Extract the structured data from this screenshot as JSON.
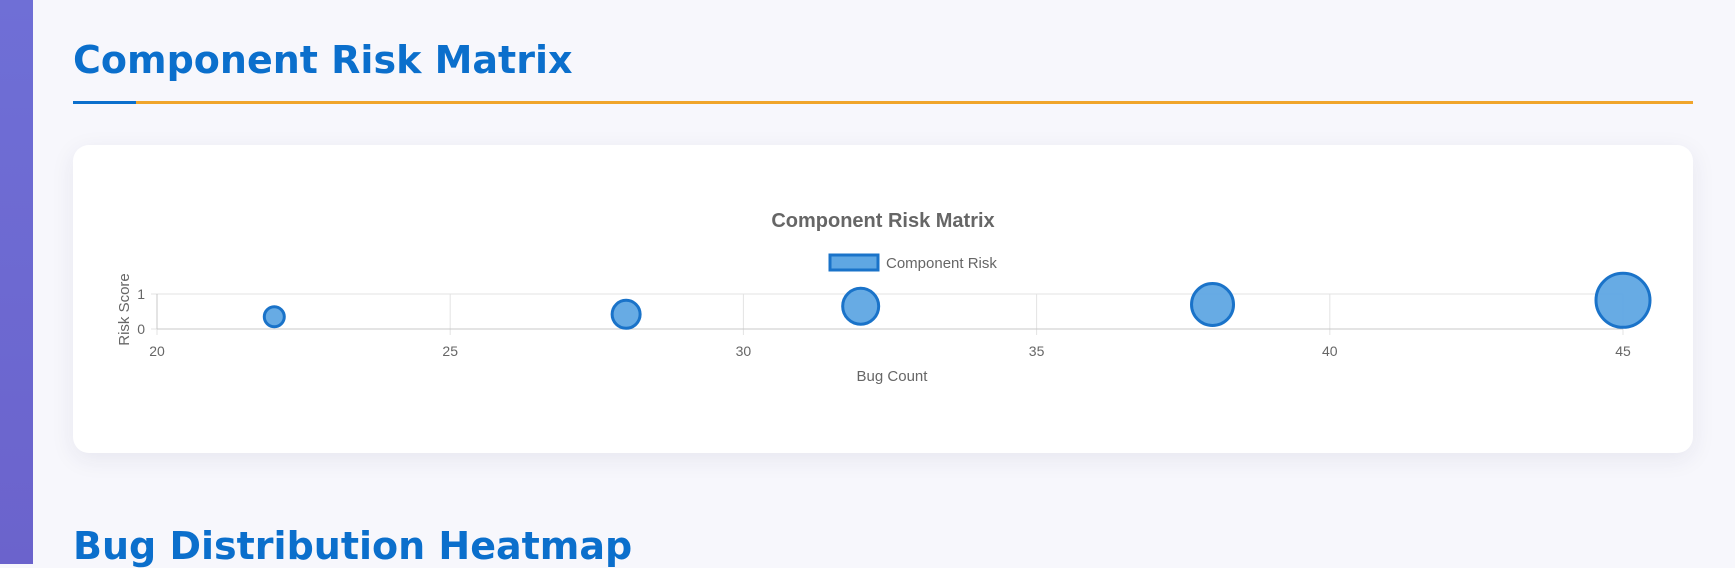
{
  "sections": {
    "risk_title": "Component Risk Matrix",
    "heatmap_title": "Bug Distribution Heatmap"
  },
  "colors": {
    "accent_blue": "#0b6fcc",
    "accent_orange": "#f0a52b",
    "point_fill": "#5fa7e3",
    "point_stroke": "#1a73c9"
  },
  "chart_data": {
    "type": "scatter",
    "title": "Component Risk Matrix",
    "xlabel": "Bug Count",
    "ylabel": "Risk Score",
    "xlim": [
      20,
      45
    ],
    "ylim": [
      0,
      1
    ],
    "xticks": [
      20,
      25,
      30,
      35,
      40,
      45
    ],
    "yticks": [
      0,
      1
    ],
    "grid": true,
    "legend": "top-center",
    "series": [
      {
        "name": "Component Risk",
        "points": [
          {
            "x": 22,
            "y": 0.35,
            "r": 10
          },
          {
            "x": 28,
            "y": 0.42,
            "r": 14
          },
          {
            "x": 32,
            "y": 0.65,
            "r": 18
          },
          {
            "x": 38,
            "y": 0.7,
            "r": 21
          },
          {
            "x": 45,
            "y": 0.82,
            "r": 27
          }
        ]
      }
    ]
  }
}
